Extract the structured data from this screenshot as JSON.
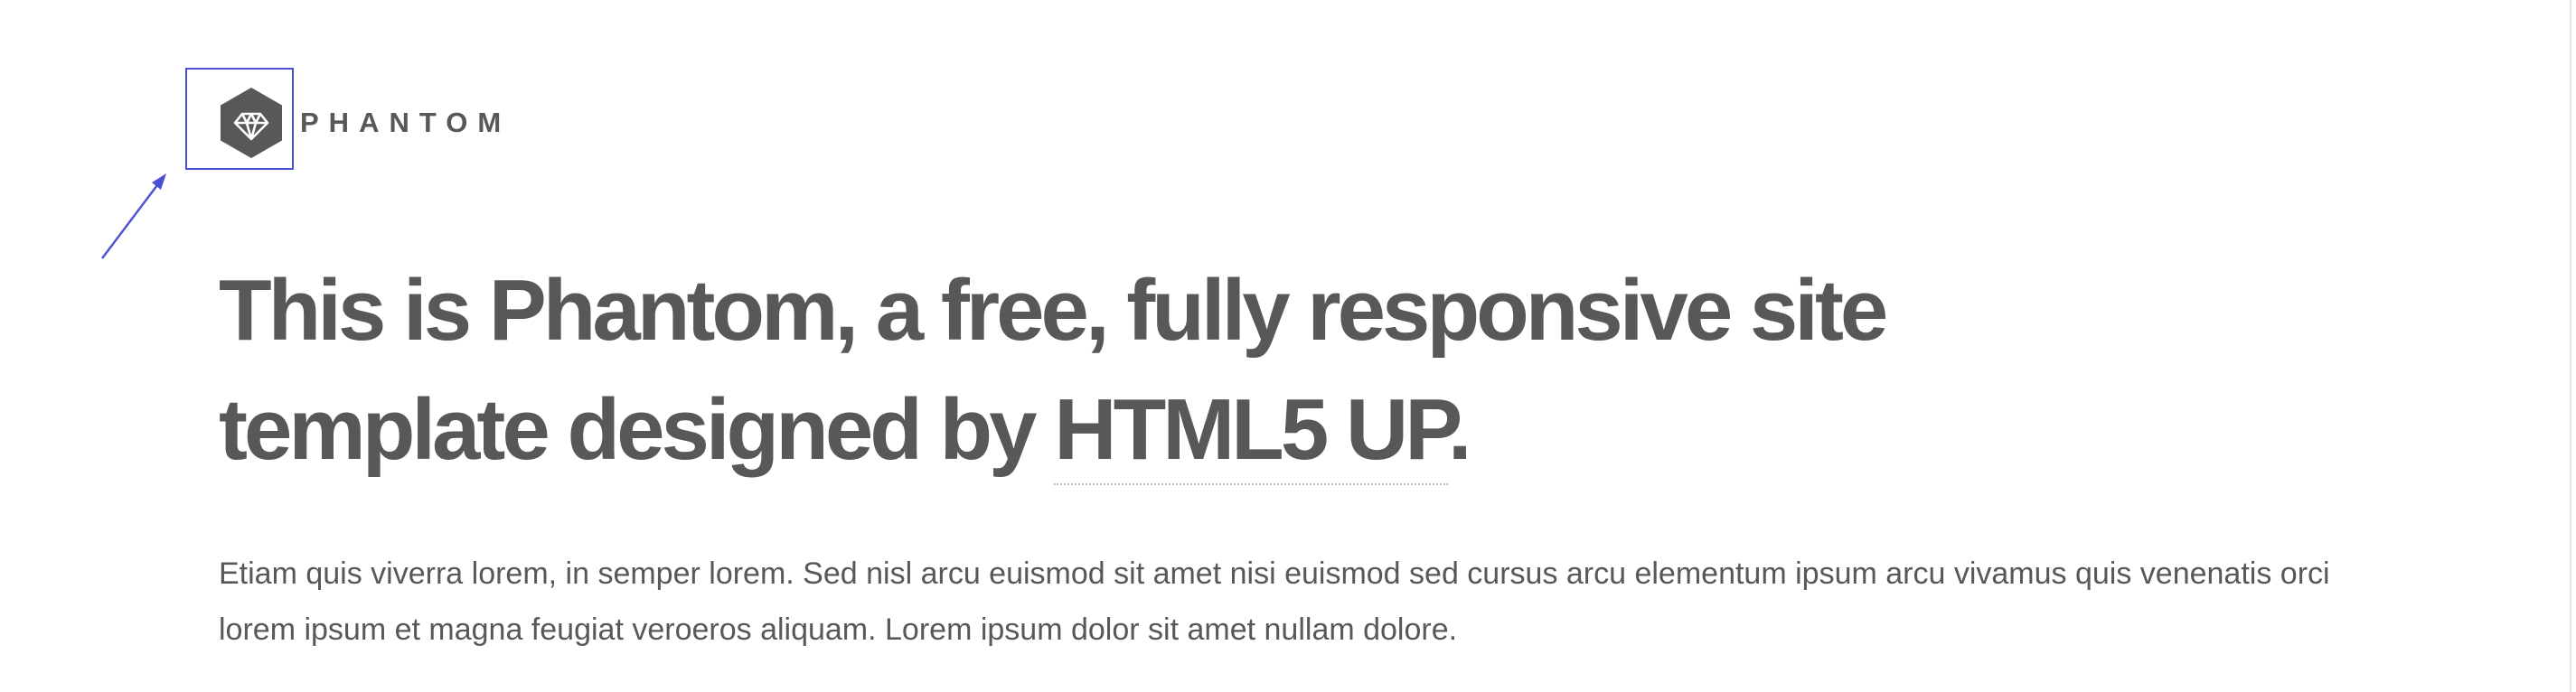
{
  "header": {
    "logo_icon": "diamond-hexagon-icon",
    "logo_text": "PHANTOM"
  },
  "main": {
    "headline_text": "This is Phantom, a free, fully responsive site template designed by ",
    "headline_link": "HTML5 UP",
    "headline_end": ".",
    "intro": "Etiam quis viverra lorem, in semper lorem. Sed nisl arcu euismod sit amet nisi euismod sed cursus arcu elementum ipsum arcu vivamus quis venenatis orci lorem ipsum et magna feugiat veroeros aliquam. Lorem ipsum dolor sit amet nullam dolore."
  },
  "colors": {
    "text": "#585858",
    "annotation": "#4a4fd6",
    "link_underline": "#bdbdbd",
    "background": "#ffffff"
  }
}
